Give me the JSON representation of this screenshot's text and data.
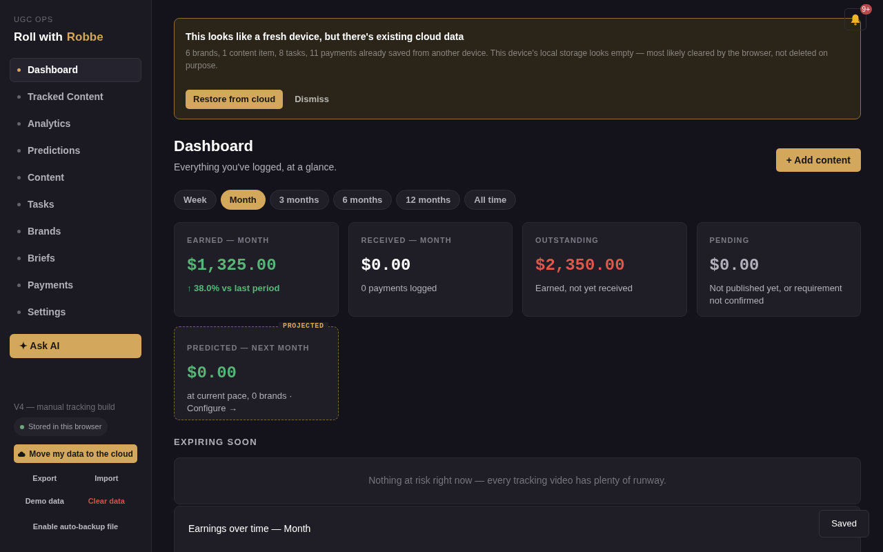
{
  "sidebar": {
    "eyebrow": "UGC OPS",
    "brand_prefix": "Roll with",
    "brand_name": "Robbe",
    "items": [
      {
        "label": "Dashboard",
        "selected": true
      },
      {
        "label": "Tracked Content",
        "selected": false
      },
      {
        "label": "Analytics",
        "selected": false
      },
      {
        "label": "Predictions",
        "selected": false
      },
      {
        "label": "Content",
        "selected": false
      },
      {
        "label": "Tasks",
        "selected": false
      },
      {
        "label": "Brands",
        "selected": false
      },
      {
        "label": "Briefs",
        "selected": false
      },
      {
        "label": "Payments",
        "selected": false
      },
      {
        "label": "Settings",
        "selected": false
      }
    ],
    "ask_ai": "✦ Ask AI",
    "version": "V4 — manual tracking build",
    "storage_status": "Stored in this browser",
    "cloud_button": "Move my data to the cloud",
    "actions": [
      {
        "label": "Export",
        "kind": "normal"
      },
      {
        "label": "Import",
        "kind": "normal"
      },
      {
        "label": "Demo data",
        "kind": "normal"
      },
      {
        "label": "Clear data",
        "kind": "danger"
      }
    ],
    "backup_link": "Enable auto-backup file"
  },
  "notifications": {
    "badge": "9+"
  },
  "banner": {
    "title": "This looks like a fresh device, but there's existing cloud data",
    "body": "6 brands, 1 content item, 8 tasks, 11 payments already saved from another device. This device's local storage looks empty — most likely cleared by the browser, not deleted on purpose.",
    "primary": "Restore from cloud",
    "secondary": "Dismiss"
  },
  "header": {
    "title": "Dashboard",
    "subtitle": "Everything you've logged, at a glance.",
    "add_button": "+ Add content"
  },
  "periods": [
    {
      "label": "Week",
      "selected": false
    },
    {
      "label": "Month",
      "selected": true
    },
    {
      "label": "3 months",
      "selected": false
    },
    {
      "label": "6 months",
      "selected": false
    },
    {
      "label": "12 months",
      "selected": false
    },
    {
      "label": "All time",
      "selected": false
    }
  ],
  "stats": [
    {
      "label": "EARNED — MONTH",
      "value": "$1,325.00",
      "kind": "positive",
      "note": "↑ 38.0% vs last period",
      "note_highlighted": true
    },
    {
      "label": "RECEIVED — MONTH",
      "value": "$0.00",
      "kind": "neutral",
      "note": "0 payments logged",
      "note_highlighted": false
    },
    {
      "label": "OUTSTANDING",
      "value": "$2,350.00",
      "kind": "negative",
      "note": "Earned, not yet received",
      "note_highlighted": false
    },
    {
      "label": "PENDING",
      "value": "$0.00",
      "kind": "muted",
      "note": "Not published yet, or requirement not confirmed",
      "note_highlighted": false
    }
  ],
  "prediction": {
    "badge": "PROJECTED",
    "label": "PREDICTED — NEXT MONTH",
    "value": "$0.00",
    "note": "at current pace, 0 brands ·",
    "link": "Configure →"
  },
  "expiring": {
    "heading": "EXPIRING SOON",
    "empty_message": "Nothing at risk right now — every tracking video has plenty of runway."
  },
  "earnings_panel": {
    "title": "Earnings over time — Month"
  },
  "toast": "Saved"
}
